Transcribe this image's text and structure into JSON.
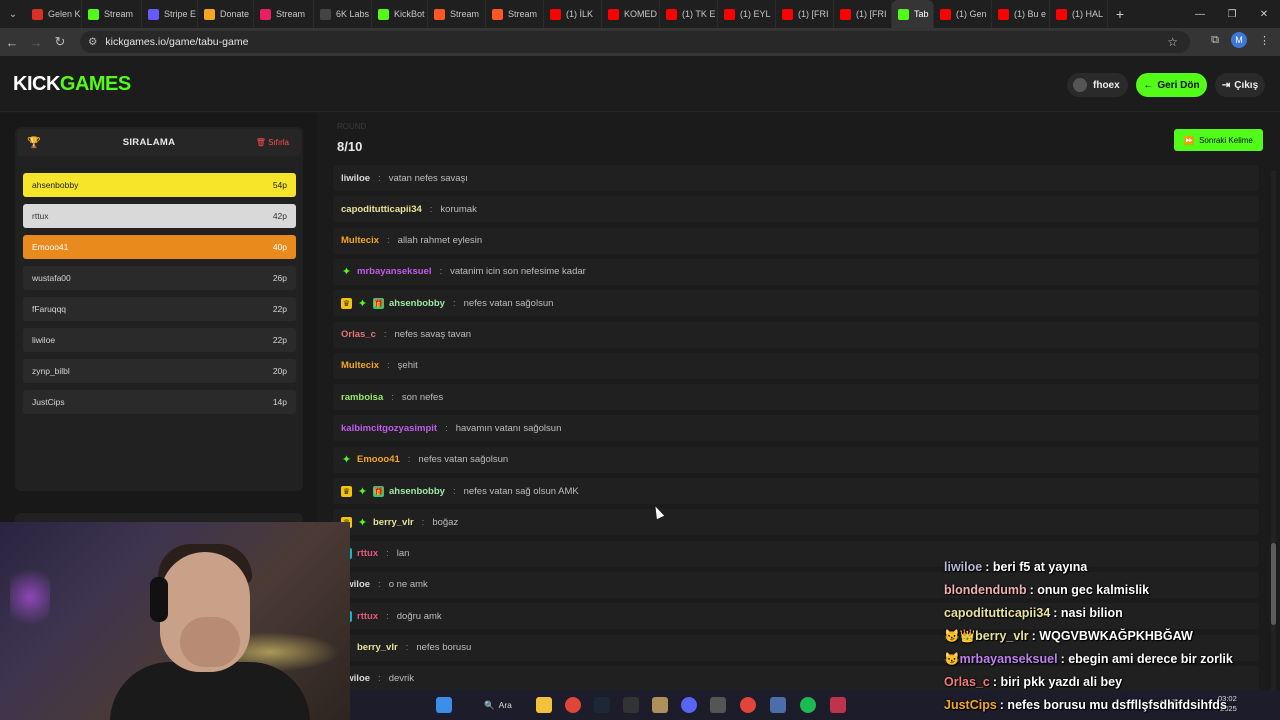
{
  "browser": {
    "tabs": [
      {
        "label": "Gelen K",
        "color": "#d93025"
      },
      {
        "label": "Stream",
        "color": "#53fc18"
      },
      {
        "label": "Stripe E",
        "color": "#635bff"
      },
      {
        "label": "Donate",
        "color": "#f5a623"
      },
      {
        "label": "Stream",
        "color": "#e91e63"
      },
      {
        "label": "6K Labs",
        "color": "#444444"
      },
      {
        "label": "KickBot",
        "color": "#53fc18"
      },
      {
        "label": "Stream",
        "color": "#ff5722"
      },
      {
        "label": "Stream",
        "color": "#ff5722"
      },
      {
        "label": "(1) İLK",
        "color": "#ff0000"
      },
      {
        "label": "KOMED",
        "color": "#ff0000"
      },
      {
        "label": "(1) TK E",
        "color": "#ff0000"
      },
      {
        "label": "(1) EYL",
        "color": "#ff0000"
      },
      {
        "label": "(1) [FRI",
        "color": "#ff0000"
      },
      {
        "label": "(1) [FRI",
        "color": "#ff0000"
      },
      {
        "label": "Tab",
        "color": "#53fc18",
        "active": true
      },
      {
        "label": "(1) Gen",
        "color": "#ff0000"
      },
      {
        "label": "(1) Bu e",
        "color": "#ff0000"
      },
      {
        "label": "(1) HAL",
        "color": "#ff0000"
      }
    ],
    "url": "kickgames.io/game/tabu-game",
    "profile_initial": "M"
  },
  "header": {
    "logo_kick": "KICK",
    "logo_games": "GAMES",
    "username": "fhoex",
    "back_label": "Geri Dön",
    "logout_label": "Çıkış"
  },
  "ranking": {
    "title": "SIRALAMA",
    "reset_label": "Sıfırla",
    "rows": [
      {
        "name": "ahsenbobby",
        "points": "54p"
      },
      {
        "name": "rttux",
        "points": "42p"
      },
      {
        "name": "Emooo41",
        "points": "40p"
      },
      {
        "name": "wustafa00",
        "points": "26p"
      },
      {
        "name": "fFaruqqq",
        "points": "22p"
      },
      {
        "name": "liwiloe",
        "points": "22p"
      },
      {
        "name": "zynp_bilbl",
        "points": "20p"
      },
      {
        "name": "JustCips",
        "points": "14p"
      }
    ]
  },
  "game": {
    "round_label": "ROUND",
    "round_count": "8/10",
    "next_label": "Sonraki Kelime"
  },
  "chat": [
    {
      "badges": [],
      "user": "liwiloe",
      "color": "#d8d8d8",
      "msg": "vatan nefes savaşı"
    },
    {
      "badges": [],
      "user": "capoditutticapii34",
      "color": "#e9e29a",
      "msg": "korumak"
    },
    {
      "badges": [],
      "user": "Multecix",
      "color": "#f5a623",
      "msg": "allah rahmet eylesin"
    },
    {
      "badges": [
        "spark"
      ],
      "user": "mrbayanseksuel",
      "color": "#c05bea",
      "msg": "vatanim icin son nefesime kadar"
    },
    {
      "badges": [
        "crown",
        "spark",
        "gift"
      ],
      "user": "ahsenbobby",
      "color": "#9be8a3",
      "msg": "nefes vatan sağolsun"
    },
    {
      "badges": [],
      "user": "Orlas_c",
      "color": "#e57373",
      "msg": "nefes savaş tavan"
    },
    {
      "badges": [],
      "user": "Multecix",
      "color": "#f5a623",
      "msg": "şehit"
    },
    {
      "badges": [],
      "user": "ramboisa",
      "color": "#9be86b",
      "msg": "son nefes"
    },
    {
      "badges": [],
      "user": "kalbimcitgozyasimpit",
      "color": "#c05bea",
      "msg": "havamın vatanı sağolsun"
    },
    {
      "badges": [
        "spark"
      ],
      "user": "Emooo41",
      "color": "#f5a623",
      "msg": "nefes vatan sağolsun"
    },
    {
      "badges": [
        "crown",
        "spark",
        "gift"
      ],
      "user": "ahsenbobby",
      "color": "#9be8a3",
      "msg": "nefes vatan sağ olsun AMK"
    },
    {
      "badges": [
        "crown",
        "spark"
      ],
      "user": "berry_vlr",
      "color": "#e9e29a",
      "msg": "boğaz"
    },
    {
      "badges": [
        "sub"
      ],
      "user": "rttux",
      "color": "#e05b7a",
      "msg": "lan"
    },
    {
      "badges": [],
      "user": "liwiloe",
      "color": "#d8d8d8",
      "msg": "o ne amk"
    },
    {
      "badges": [
        "sub"
      ],
      "user": "rttux",
      "color": "#e05b7a",
      "msg": "doğru amk"
    },
    {
      "badges": [
        "spark"
      ],
      "user": "berry_vlr",
      "color": "#e9e29a",
      "msg": "nefes borusu"
    },
    {
      "badges": [],
      "user": "liwiloe",
      "color": "#d8d8d8",
      "msg": "devrik"
    }
  ],
  "overlay_chat": [
    {
      "prefix": "",
      "user": "liwiloe",
      "color": "#b8b8d8",
      "msg": ": beri f5 at yayına"
    },
    {
      "prefix": "",
      "user": "blondendumb",
      "color": "#f0b0b0",
      "msg": ": onun gec kalmislik"
    },
    {
      "prefix": "",
      "user": "capoditutticapii34",
      "color": "#e9e29a",
      "msg": ": nasi bilion"
    },
    {
      "prefix": "😼👑",
      "user": "berry_vlr",
      "color": "#e9e29a",
      "msg": ": WQGVBWKAĞPKHBĞAW"
    },
    {
      "prefix": "😼",
      "user": "mrbayanseksuel",
      "color": "#c080f0",
      "msg": ": ebegin ami derece bir zorlik"
    },
    {
      "prefix": "",
      "user": "Orlas_c",
      "color": "#f07a7a",
      "msg": ": biri pkk yazdı ali bey"
    },
    {
      "prefix": "",
      "user": "JustCips",
      "color": "#f5a623",
      "msg": ": nefes borusu mu dsffllşfsdhifdsihfds"
    }
  ],
  "taskbar": {
    "search_label": "Ara",
    "time": "03:02",
    "date": "2025"
  }
}
